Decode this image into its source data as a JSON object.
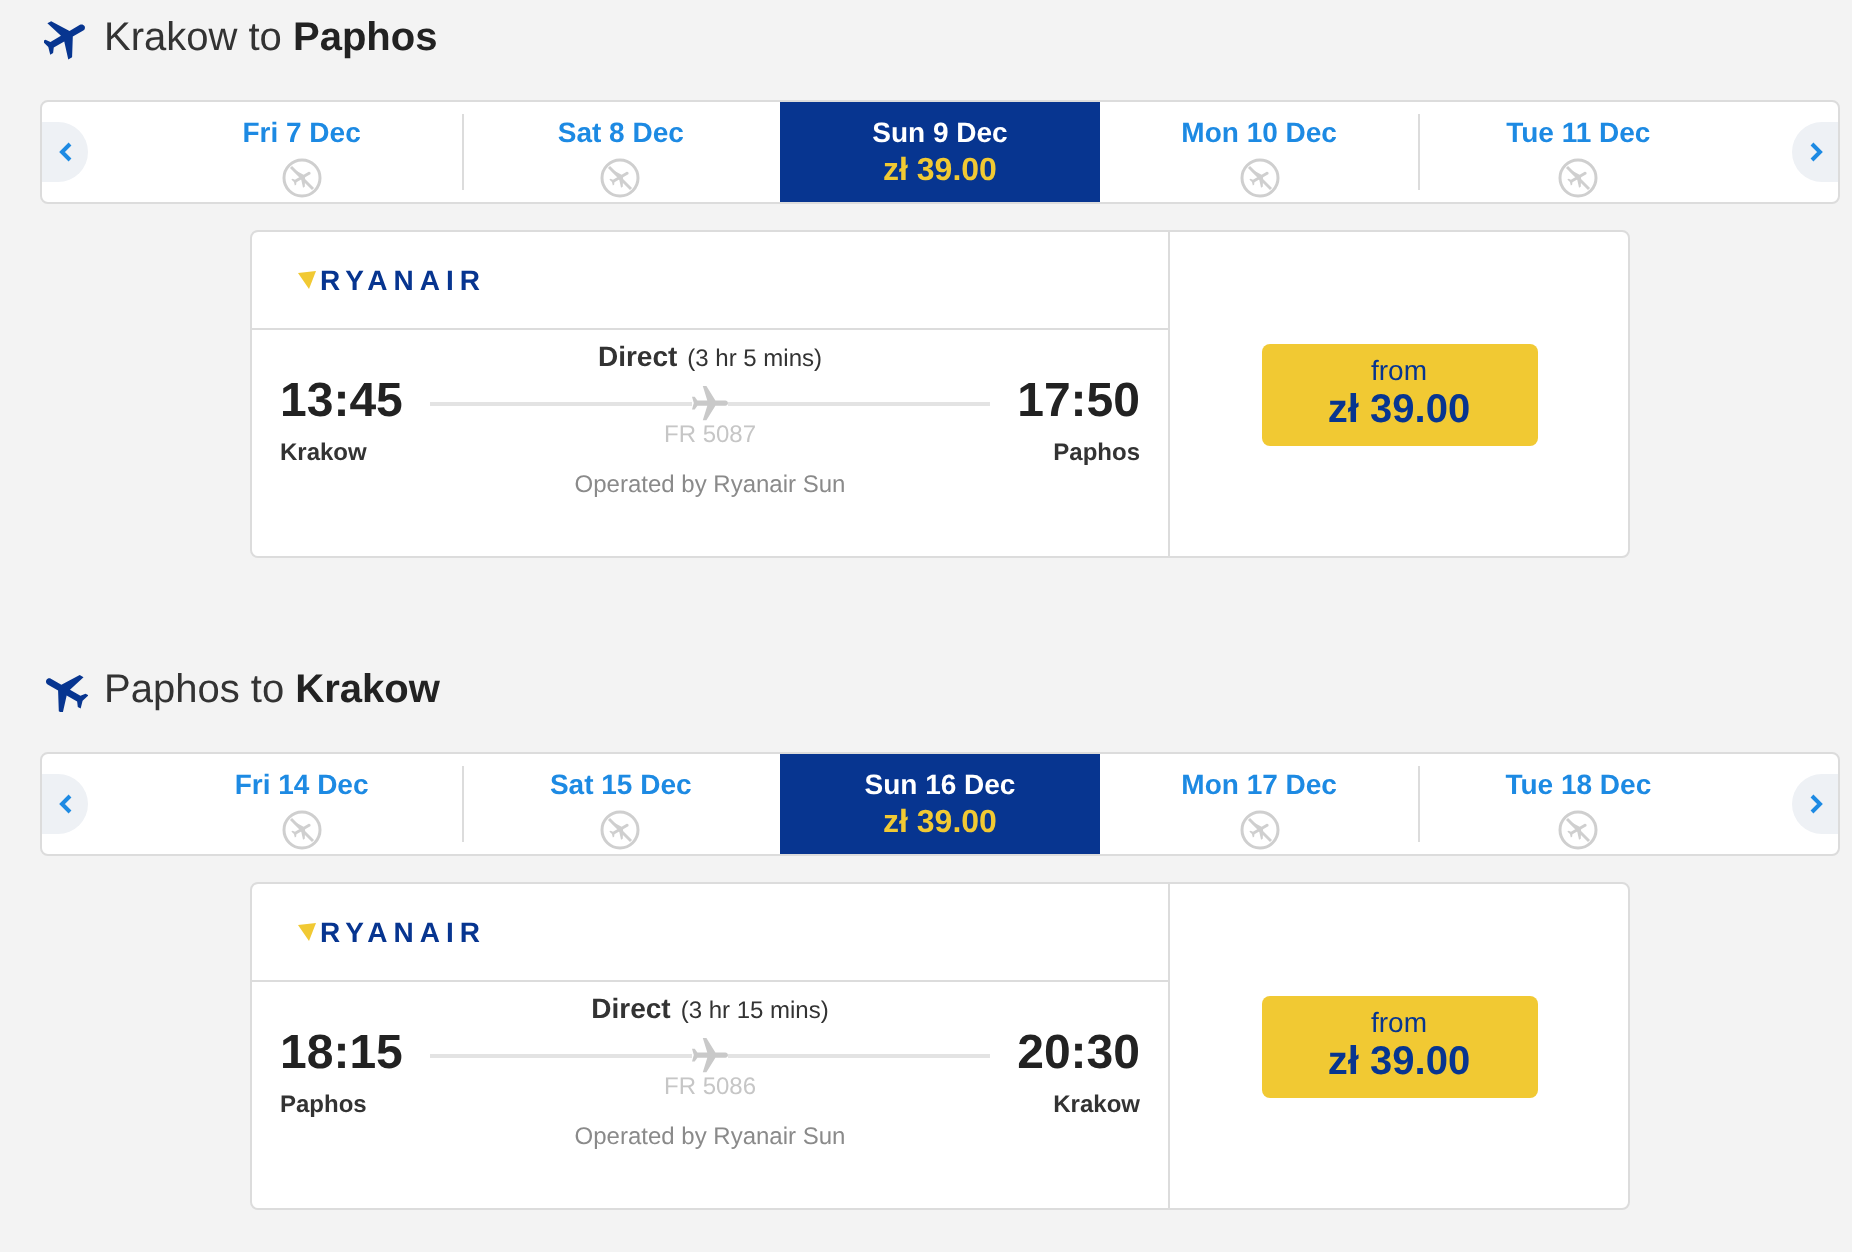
{
  "journeys": [
    {
      "kind": "outbound",
      "heading": "Krakow to **Paphos**",
      "dates": [
        {
          "label": "Fri 7 Dec",
          "selected": false,
          "kind": "no-flights"
        },
        {
          "label": "Sat 8 Dec",
          "selected": false,
          "kind": "no-flights"
        },
        {
          "label": "Sun 9 Dec",
          "selected": true,
          "kind": "fare",
          "price": "zł 39.00"
        },
        {
          "label": "Mon 10 Dec",
          "selected": false,
          "kind": "no-flights"
        },
        {
          "label": "Tue 11 Dec",
          "selected": false,
          "kind": "no-flights"
        }
      ],
      "flight": {
        "airline": "RYANAIR",
        "stops": "Direct",
        "duration": "(3 hr 5 mins)",
        "departure_time": "13:45",
        "departure_city": "Krakow",
        "flight_number": "FR 5087",
        "arrival_time": "17:50",
        "arrival_city": "Paphos",
        "operator": "Operated by Ryanair Sun",
        "price_label": "from",
        "price": "zł 39.00"
      }
    },
    {
      "kind": "return",
      "heading": "Paphos to **Krakow**",
      "dates": [
        {
          "label": "Fri 14 Dec",
          "selected": false,
          "kind": "no-flights"
        },
        {
          "label": "Sat 15 Dec",
          "selected": false,
          "kind": "no-flights"
        },
        {
          "label": "Sun 16 Dec",
          "selected": true,
          "kind": "fare",
          "price": "zł 39.00"
        },
        {
          "label": "Mon 17 Dec",
          "selected": false,
          "kind": "no-flights"
        },
        {
          "label": "Tue 18 Dec",
          "selected": false,
          "kind": "no-flights"
        }
      ],
      "flight": {
        "airline": "RYANAIR",
        "stops": "Direct",
        "duration": "(3 hr 15 mins)",
        "departure_time": "18:15",
        "departure_city": "Paphos",
        "flight_number": "FR 5086",
        "arrival_time": "20:30",
        "arrival_city": "Krakow",
        "operator": "Operated by Ryanair Sun",
        "price_label": "from",
        "price": "zł 39.00"
      }
    }
  ]
}
